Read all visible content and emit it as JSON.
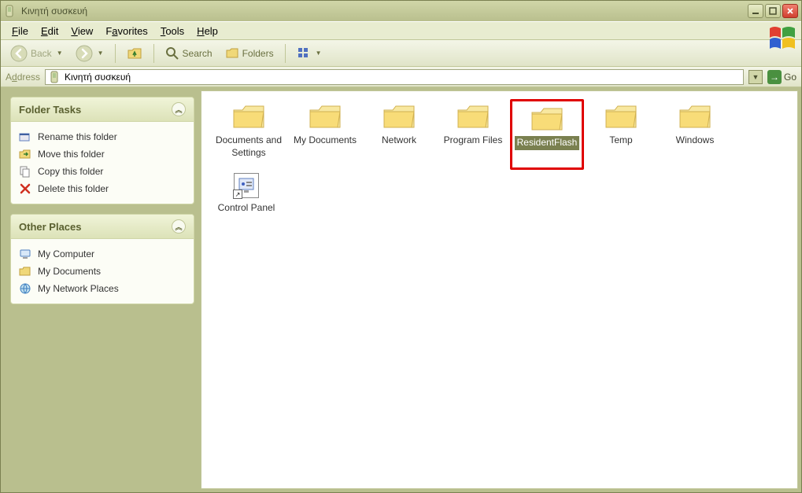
{
  "window": {
    "title": "Κινητή συσκευή"
  },
  "menu": {
    "file": "File",
    "edit": "Edit",
    "view": "View",
    "favorites": "Favorites",
    "tools": "Tools",
    "help": "Help"
  },
  "toolbar": {
    "back": "Back",
    "search": "Search",
    "folders": "Folders"
  },
  "address": {
    "label_prefix": "A",
    "label_rest": "ddress",
    "value": "Κινητή συσκευή",
    "go": "Go"
  },
  "sidebar": {
    "folder_tasks": {
      "title": "Folder Tasks",
      "rename": "Rename this folder",
      "move": "Move this folder",
      "copy": "Copy this folder",
      "delete": "Delete this folder"
    },
    "other_places": {
      "title": "Other Places",
      "my_computer": "My Computer",
      "my_documents": "My Documents",
      "my_network": "My Network Places"
    }
  },
  "files": {
    "docs_settings": "Documents and Settings",
    "my_documents": "My Documents",
    "network": "Network",
    "program_files": "Program Files",
    "resident_flash": "ResidentFlash",
    "temp": "Temp",
    "windows": "Windows",
    "control_panel": "Control Panel"
  }
}
